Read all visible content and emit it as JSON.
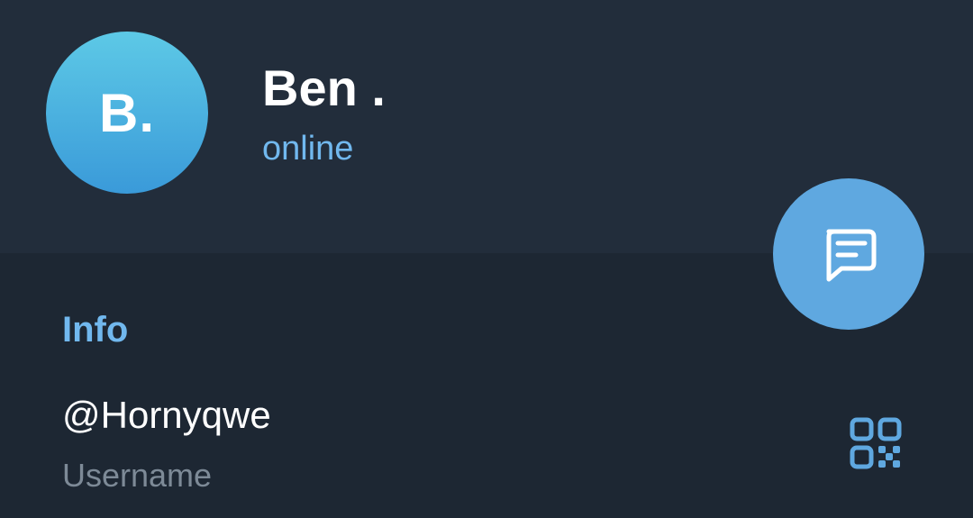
{
  "profile": {
    "initials": "B.",
    "name": "Ben .",
    "status": "online"
  },
  "actions": {
    "message_icon": "message-bubble-icon"
  },
  "info": {
    "section_title": "Info",
    "username_value": "@Hornyqwe",
    "username_label": "Username",
    "qr_icon": "qr-code-icon"
  },
  "colors": {
    "background": "#1d2733",
    "header_background": "#222d3b",
    "accent": "#71b8ee",
    "fab": "#5fa8e0",
    "avatar_gradient_top": "#5dc9e6",
    "avatar_gradient_bottom": "#3a9ad9",
    "secondary_text": "#7d8a97"
  }
}
